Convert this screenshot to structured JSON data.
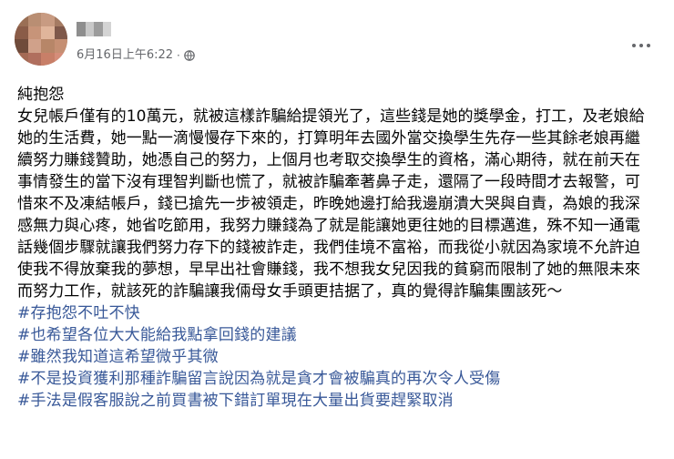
{
  "post": {
    "date_text": "6月16日上午6:22",
    "separator": "·",
    "privacy_icon": "globe-icon",
    "more_icon": "more-options-icon",
    "title": "純抱怨",
    "body": "女兒帳戶僅有的10萬元，就被這樣詐騙給提領光了，這些錢是她的獎學金，打工，及老娘給她的生活費，她一點一滴慢慢存下來的，打算明年去國外當交換學生先存一些其餘老娘再繼續努力賺錢贊助，她憑自己的努力，上個月也考取交換學生的資格，滿心期待，就在前天在事情發生的當下沒有理智判斷也慌了，就被詐騙牽著鼻子走，還隔了一段時間才去報警，可惜來不及凍結帳戶，錢已搶先一步被領走，昨晚她邊打給我邊崩潰大哭與自責，為娘的我深感無力與心疼，她省吃節用，我努力賺錢為了就是能讓她更往她的目標邁進，殊不知一通電話幾個步驟就讓我們努力存下的錢被詐走，我們佳境不富裕，而我從小就因為家境不允許迫使我不得放棄我的夢想，早早出社會賺錢，我不想我女兒因我的貧窮而限制了她的無限未來而努力工作，就該死的詐騙讓我倆母女手頭更拮据了，真的覺得詐騙集團該死～",
    "hashtags": [
      "#存抱怨不吐不快",
      "#也希望各位大大能給我點拿回錢的建議",
      "#雖然我知道這希望微乎其微",
      "#不是投資獲利那種詐騙留言說因為就是貪才會被騙真的再次令人受傷",
      "#手法是假客服說之前買書被下錯訂單現在大量出貨要趕緊取消"
    ]
  },
  "colors": {
    "text": "#050505",
    "meta": "#65676b",
    "hashtag": "#385898",
    "background": "#ffffff"
  }
}
